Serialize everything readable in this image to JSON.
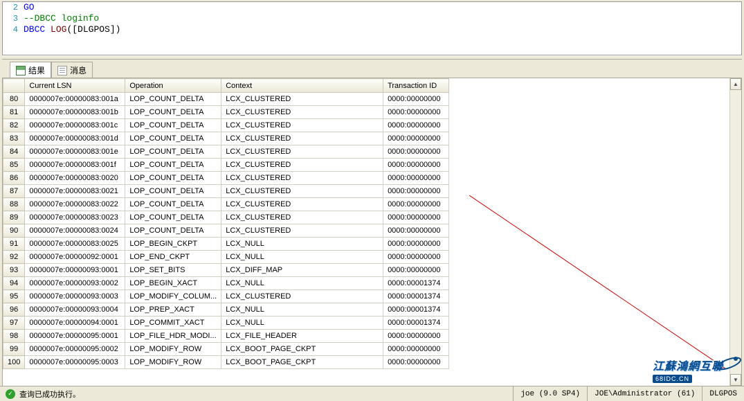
{
  "editor": {
    "lines": [
      {
        "num": "2",
        "tokens": [
          {
            "cls": "kw",
            "t": "GO"
          }
        ]
      },
      {
        "num": "3",
        "tokens": [
          {
            "cls": "comment",
            "t": "--DBCC loginfo"
          }
        ]
      },
      {
        "num": "4",
        "tokens": [
          {
            "cls": "kw",
            "t": "DBCC"
          },
          {
            "cls": "",
            "t": " "
          },
          {
            "cls": "func",
            "t": "LOG"
          },
          {
            "cls": "",
            "t": "([DLGPOS])"
          }
        ]
      }
    ]
  },
  "tabs": {
    "results": "结果",
    "messages": "消息"
  },
  "grid": {
    "headers": {
      "lsn": "Current LSN",
      "op": "Operation",
      "ctx": "Context",
      "txn": "Transaction ID"
    },
    "rows": [
      {
        "n": "80",
        "lsn": "0000007e:00000083:001a",
        "op": "LOP_COUNT_DELTA",
        "ctx": "LCX_CLUSTERED",
        "txn": "0000:00000000"
      },
      {
        "n": "81",
        "lsn": "0000007e:00000083:001b",
        "op": "LOP_COUNT_DELTA",
        "ctx": "LCX_CLUSTERED",
        "txn": "0000:00000000"
      },
      {
        "n": "82",
        "lsn": "0000007e:00000083:001c",
        "op": "LOP_COUNT_DELTA",
        "ctx": "LCX_CLUSTERED",
        "txn": "0000:00000000"
      },
      {
        "n": "83",
        "lsn": "0000007e:00000083:001d",
        "op": "LOP_COUNT_DELTA",
        "ctx": "LCX_CLUSTERED",
        "txn": "0000:00000000"
      },
      {
        "n": "84",
        "lsn": "0000007e:00000083:001e",
        "op": "LOP_COUNT_DELTA",
        "ctx": "LCX_CLUSTERED",
        "txn": "0000:00000000"
      },
      {
        "n": "85",
        "lsn": "0000007e:00000083:001f",
        "op": "LOP_COUNT_DELTA",
        "ctx": "LCX_CLUSTERED",
        "txn": "0000:00000000"
      },
      {
        "n": "86",
        "lsn": "0000007e:00000083:0020",
        "op": "LOP_COUNT_DELTA",
        "ctx": "LCX_CLUSTERED",
        "txn": "0000:00000000"
      },
      {
        "n": "87",
        "lsn": "0000007e:00000083:0021",
        "op": "LOP_COUNT_DELTA",
        "ctx": "LCX_CLUSTERED",
        "txn": "0000:00000000"
      },
      {
        "n": "88",
        "lsn": "0000007e:00000083:0022",
        "op": "LOP_COUNT_DELTA",
        "ctx": "LCX_CLUSTERED",
        "txn": "0000:00000000"
      },
      {
        "n": "89",
        "lsn": "0000007e:00000083:0023",
        "op": "LOP_COUNT_DELTA",
        "ctx": "LCX_CLUSTERED",
        "txn": "0000:00000000"
      },
      {
        "n": "90",
        "lsn": "0000007e:00000083:0024",
        "op": "LOP_COUNT_DELTA",
        "ctx": "LCX_CLUSTERED",
        "txn": "0000:00000000"
      },
      {
        "n": "91",
        "lsn": "0000007e:00000083:0025",
        "op": "LOP_BEGIN_CKPT",
        "ctx": "LCX_NULL",
        "txn": "0000:00000000"
      },
      {
        "n": "92",
        "lsn": "0000007e:00000092:0001",
        "op": "LOP_END_CKPT",
        "ctx": "LCX_NULL",
        "txn": "0000:00000000"
      },
      {
        "n": "93",
        "lsn": "0000007e:00000093:0001",
        "op": "LOP_SET_BITS",
        "ctx": "LCX_DIFF_MAP",
        "txn": "0000:00000000"
      },
      {
        "n": "94",
        "lsn": "0000007e:00000093:0002",
        "op": "LOP_BEGIN_XACT",
        "ctx": "LCX_NULL",
        "txn": "0000:00001374"
      },
      {
        "n": "95",
        "lsn": "0000007e:00000093:0003",
        "op": "LOP_MODIFY_COLUM...",
        "ctx": "LCX_CLUSTERED",
        "txn": "0000:00001374"
      },
      {
        "n": "96",
        "lsn": "0000007e:00000093:0004",
        "op": "LOP_PREP_XACT",
        "ctx": "LCX_NULL",
        "txn": "0000:00001374"
      },
      {
        "n": "97",
        "lsn": "0000007e:00000094:0001",
        "op": "LOP_COMMIT_XACT",
        "ctx": "LCX_NULL",
        "txn": "0000:00001374"
      },
      {
        "n": "98",
        "lsn": "0000007e:00000095:0001",
        "op": "LOP_FILE_HDR_MODI...",
        "ctx": "LCX_FILE_HEADER",
        "txn": "0000:00000000"
      },
      {
        "n": "99",
        "lsn": "0000007e:00000095:0002",
        "op": "LOP_MODIFY_ROW",
        "ctx": "LCX_BOOT_PAGE_CKPT",
        "txn": "0000:00000000"
      },
      {
        "n": "100",
        "lsn": "0000007e:00000095:0003",
        "op": "LOP_MODIFY_ROW",
        "ctx": "LCX_BOOT_PAGE_CKPT",
        "txn": "0000:00000000"
      }
    ]
  },
  "status": {
    "text": "查询已成功执行。",
    "server": "joe (9.0 SP4)",
    "user": "JOE\\Administrator (61)",
    "db": "DLGPOS"
  },
  "watermark": {
    "cn": "江蘇鴻網互聯",
    "url": "68IDC.CN"
  }
}
